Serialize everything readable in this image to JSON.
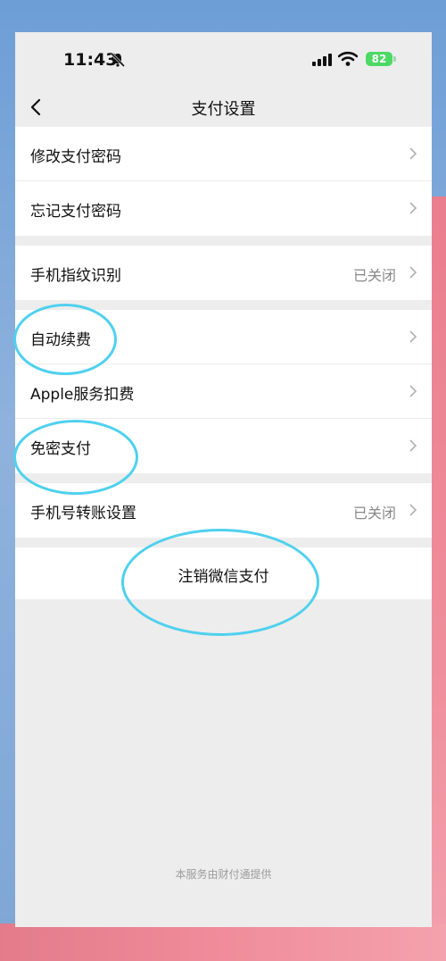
{
  "status_bar": {
    "time": "11:43",
    "battery": "82"
  },
  "header": {
    "title": "支付设置"
  },
  "groups": [
    {
      "items": [
        {
          "label": "修改支付密码"
        },
        {
          "label": "忘记支付密码"
        }
      ]
    },
    {
      "items": [
        {
          "label": "手机指纹识别",
          "value": "已关闭"
        }
      ]
    },
    {
      "items": [
        {
          "label": "自动续费"
        },
        {
          "label": "Apple服务扣费"
        },
        {
          "label": "免密支付"
        }
      ]
    },
    {
      "items": [
        {
          "label": "手机号转账设置",
          "value": "已关闭"
        }
      ]
    }
  ],
  "deactivate": {
    "label": "注销微信支付"
  },
  "footer": {
    "text": "本服务由财付通提供"
  },
  "colors": {
    "highlight": "#4fd1ee",
    "battery": "#4cd964",
    "background": "#ededed"
  },
  "icons": [
    "mute-bell-icon",
    "signal-icon",
    "wifi-icon",
    "battery-icon",
    "back-chevron-icon",
    "chevron-right-icon"
  ]
}
